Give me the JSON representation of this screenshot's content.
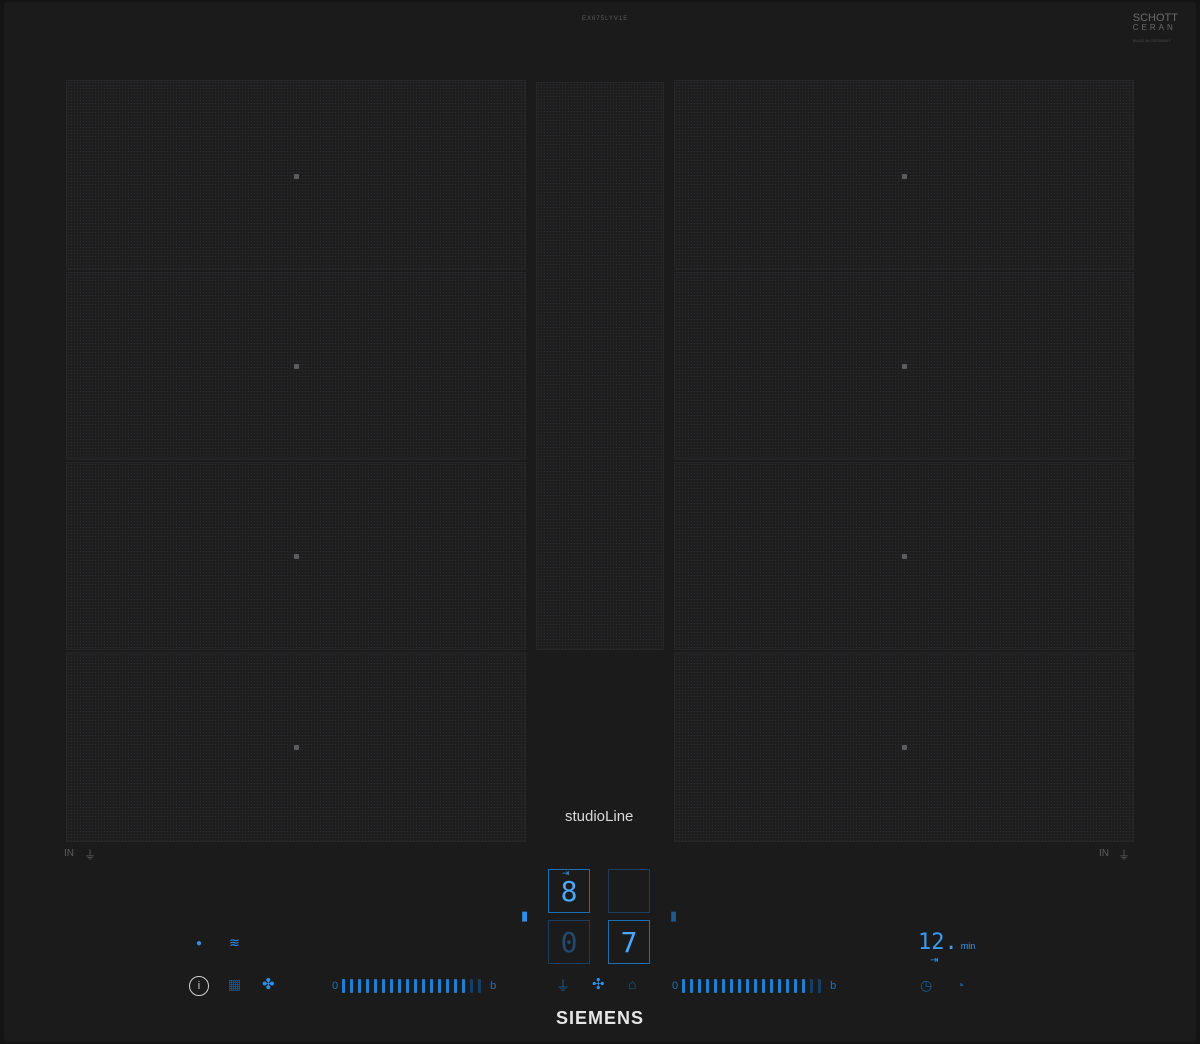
{
  "top": {
    "model_code": "EX675LYV1E",
    "glass_brand": {
      "line1": "SCHOTT",
      "line2": "CERAN",
      "line3": "MADE IN GERMANY"
    }
  },
  "center": {
    "series_label": "studioLine"
  },
  "zones": {
    "left_mode": "IN",
    "right_mode": "IN"
  },
  "display": {
    "left_top_digit": "8",
    "left_bottom_digit": "0",
    "right_bottom_digit": "7",
    "timer_value": "12.",
    "timer_unit": "min"
  },
  "sliders": {
    "left_start": "0",
    "left_end": "b",
    "right_start": "0",
    "right_end": "b",
    "left_ticks": 18,
    "right_ticks": 18
  },
  "brand": {
    "name": "SIEMENS"
  },
  "colors": {
    "accent": "#2f8fe8",
    "glass": "#1b1b1c"
  }
}
